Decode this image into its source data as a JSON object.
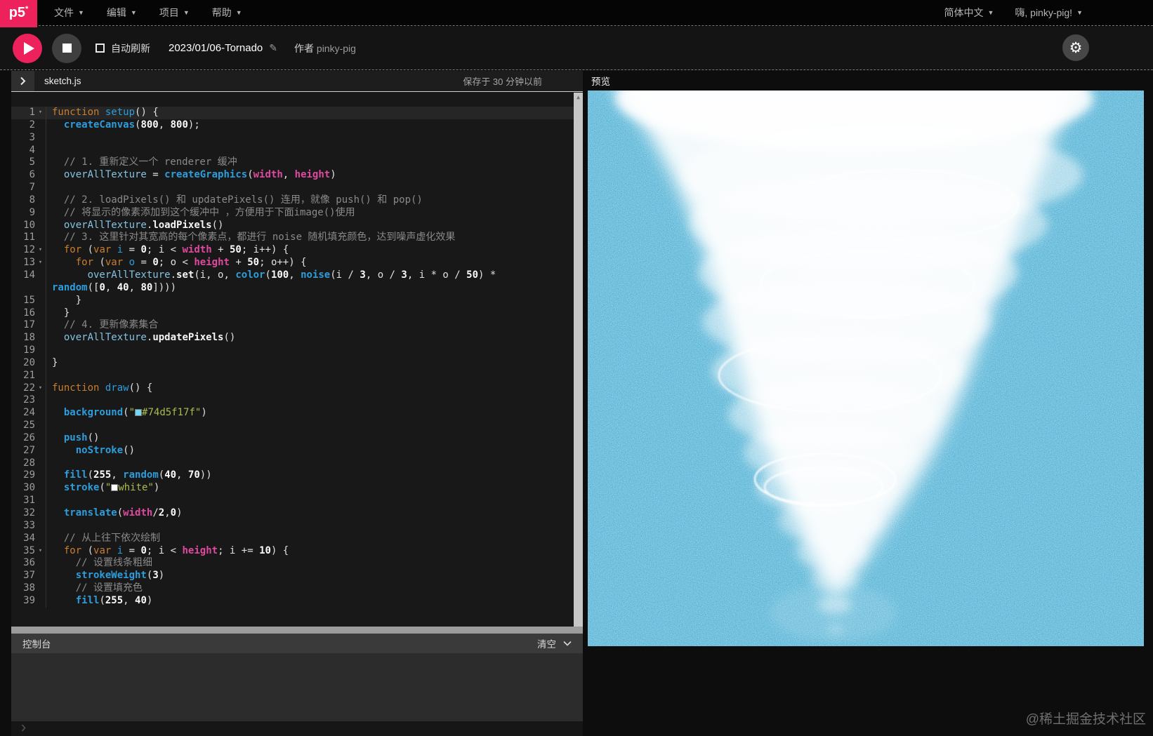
{
  "menubar": {
    "logo": "p5*",
    "items": [
      {
        "label": "文件"
      },
      {
        "label": "编辑"
      },
      {
        "label": "项目"
      },
      {
        "label": "帮助"
      }
    ],
    "language": "简体中文",
    "user": "嗨, pinky-pig!"
  },
  "toolbar": {
    "auto_refresh_label": "自动刷新",
    "project_title": "2023/01/06-Tornado",
    "author_label": "作者",
    "author_name": "pinky-pig"
  },
  "editor": {
    "filename": "sketch.js",
    "saved_status": "保存于 30 分钟以前",
    "lines": [
      {
        "n": 1,
        "fold": true,
        "active": true,
        "tokens": [
          [
            "kw",
            "function"
          ],
          [
            "pl",
            " "
          ],
          [
            "def",
            "setup"
          ],
          [
            "pl",
            "() {"
          ]
        ]
      },
      {
        "n": 2,
        "tokens": [
          [
            "pl",
            "  "
          ],
          [
            "fn",
            "createCanvas"
          ],
          [
            "pl",
            "("
          ],
          [
            "num",
            "800"
          ],
          [
            "pl",
            ", "
          ],
          [
            "num",
            "800"
          ],
          [
            "pl",
            ");"
          ]
        ]
      },
      {
        "n": 3,
        "tokens": []
      },
      {
        "n": 4,
        "tokens": []
      },
      {
        "n": 5,
        "tokens": [
          [
            "pl",
            "  "
          ],
          [
            "com",
            "// 1. 重新定义一个 renderer 缓冲"
          ]
        ]
      },
      {
        "n": 6,
        "tokens": [
          [
            "pl",
            "  "
          ],
          [
            "var",
            "overAllTexture"
          ],
          [
            "pl",
            " = "
          ],
          [
            "fn",
            "createGraphics"
          ],
          [
            "pl",
            "("
          ],
          [
            "p5",
            "width"
          ],
          [
            "pl",
            ", "
          ],
          [
            "p5",
            "height"
          ],
          [
            "pl",
            ")"
          ]
        ]
      },
      {
        "n": 7,
        "tokens": []
      },
      {
        "n": 8,
        "tokens": [
          [
            "pl",
            "  "
          ],
          [
            "com",
            "// 2. loadPixels() 和 updatePixels() 连用，就像 push() 和 pop()"
          ]
        ]
      },
      {
        "n": 9,
        "tokens": [
          [
            "pl",
            "  "
          ],
          [
            "com",
            "// 将显示的像素添加到这个缓冲中 ，方便用于下面image()使用"
          ]
        ]
      },
      {
        "n": 10,
        "tokens": [
          [
            "pl",
            "  "
          ],
          [
            "var",
            "overAllTexture"
          ],
          [
            "pl",
            "."
          ],
          [
            "meth",
            "loadPixels"
          ],
          [
            "pl",
            "()"
          ]
        ]
      },
      {
        "n": 11,
        "tokens": [
          [
            "pl",
            "  "
          ],
          [
            "com",
            "// 3. 这里针对其宽高的每个像素点，都进行 noise 随机填充颜色，达到噪声虚化效果"
          ]
        ]
      },
      {
        "n": 12,
        "fold": true,
        "tokens": [
          [
            "pl",
            "  "
          ],
          [
            "kw",
            "for"
          ],
          [
            "pl",
            " ("
          ],
          [
            "kw",
            "var"
          ],
          [
            "pl",
            " "
          ],
          [
            "def",
            "i"
          ],
          [
            "pl",
            " = "
          ],
          [
            "num",
            "0"
          ],
          [
            "pl",
            "; i < "
          ],
          [
            "p5",
            "width"
          ],
          [
            "pl",
            " + "
          ],
          [
            "num",
            "50"
          ],
          [
            "pl",
            "; i++) {"
          ]
        ]
      },
      {
        "n": 13,
        "fold": true,
        "tokens": [
          [
            "pl",
            "    "
          ],
          [
            "kw",
            "for"
          ],
          [
            "pl",
            " ("
          ],
          [
            "kw",
            "var"
          ],
          [
            "pl",
            " "
          ],
          [
            "def",
            "o"
          ],
          [
            "pl",
            " = "
          ],
          [
            "num",
            "0"
          ],
          [
            "pl",
            "; o < "
          ],
          [
            "p5",
            "height"
          ],
          [
            "pl",
            " + "
          ],
          [
            "num",
            "50"
          ],
          [
            "pl",
            "; o++) {"
          ]
        ]
      },
      {
        "n": 14,
        "tokens": [
          [
            "pl",
            "      "
          ],
          [
            "var",
            "overAllTexture"
          ],
          [
            "pl",
            "."
          ],
          [
            "meth",
            "set"
          ],
          [
            "pl",
            "(i, o, "
          ],
          [
            "fn",
            "color"
          ],
          [
            "pl",
            "("
          ],
          [
            "num",
            "100"
          ],
          [
            "pl",
            ", "
          ],
          [
            "fn",
            "noise"
          ],
          [
            "pl",
            "(i / "
          ],
          [
            "num",
            "3"
          ],
          [
            "pl",
            ", o / "
          ],
          [
            "num",
            "3"
          ],
          [
            "pl",
            ", i * o / "
          ],
          [
            "num",
            "50"
          ],
          [
            "pl",
            ") * "
          ],
          [
            "br",
            ""
          ],
          [
            "fn",
            "random"
          ],
          [
            "pl",
            "(["
          ],
          [
            "num",
            "0"
          ],
          [
            "pl",
            ", "
          ],
          [
            "num",
            "40"
          ],
          [
            "pl",
            ", "
          ],
          [
            "num",
            "80"
          ],
          [
            "pl",
            "])))"
          ]
        ]
      },
      {
        "n": 15,
        "tokens": [
          [
            "pl",
            "    }"
          ]
        ]
      },
      {
        "n": 16,
        "tokens": [
          [
            "pl",
            "  }"
          ]
        ]
      },
      {
        "n": 17,
        "tokens": [
          [
            "pl",
            "  "
          ],
          [
            "com",
            "// 4. 更新像素集合"
          ]
        ]
      },
      {
        "n": 18,
        "tokens": [
          [
            "pl",
            "  "
          ],
          [
            "var",
            "overAllTexture"
          ],
          [
            "pl",
            "."
          ],
          [
            "meth",
            "updatePixels"
          ],
          [
            "pl",
            "()"
          ]
        ]
      },
      {
        "n": 19,
        "tokens": []
      },
      {
        "n": 20,
        "tokens": [
          [
            "pl",
            "}"
          ]
        ]
      },
      {
        "n": 21,
        "tokens": []
      },
      {
        "n": 22,
        "fold": true,
        "tokens": [
          [
            "kw",
            "function"
          ],
          [
            "pl",
            " "
          ],
          [
            "def",
            "draw"
          ],
          [
            "pl",
            "() {"
          ]
        ]
      },
      {
        "n": 23,
        "tokens": []
      },
      {
        "n": 24,
        "tokens": [
          [
            "pl",
            "  "
          ],
          [
            "fn",
            "background"
          ],
          [
            "pl",
            "("
          ],
          [
            "str",
            "\""
          ],
          [
            "chip",
            "#74d5f1"
          ],
          [
            "str",
            "#74d5f17f\""
          ],
          [
            "pl",
            ")"
          ]
        ]
      },
      {
        "n": 25,
        "tokens": []
      },
      {
        "n": 26,
        "tokens": [
          [
            "pl",
            "  "
          ],
          [
            "fn",
            "push"
          ],
          [
            "pl",
            "()"
          ]
        ]
      },
      {
        "n": 27,
        "tokens": [
          [
            "pl",
            "    "
          ],
          [
            "fn",
            "noStroke"
          ],
          [
            "pl",
            "()"
          ]
        ]
      },
      {
        "n": 28,
        "tokens": []
      },
      {
        "n": 29,
        "tokens": [
          [
            "pl",
            "  "
          ],
          [
            "fn",
            "fill"
          ],
          [
            "pl",
            "("
          ],
          [
            "num",
            "255"
          ],
          [
            "pl",
            ", "
          ],
          [
            "fn",
            "random"
          ],
          [
            "pl",
            "("
          ],
          [
            "num",
            "40"
          ],
          [
            "pl",
            ", "
          ],
          [
            "num",
            "70"
          ],
          [
            "pl",
            "))"
          ]
        ]
      },
      {
        "n": 30,
        "tokens": [
          [
            "pl",
            "  "
          ],
          [
            "fn",
            "stroke"
          ],
          [
            "pl",
            "("
          ],
          [
            "str",
            "\""
          ],
          [
            "chip",
            "#ffffff"
          ],
          [
            "str",
            "white\""
          ],
          [
            "pl",
            ")"
          ]
        ]
      },
      {
        "n": 31,
        "tokens": []
      },
      {
        "n": 32,
        "tokens": [
          [
            "pl",
            "  "
          ],
          [
            "fn",
            "translate"
          ],
          [
            "pl",
            "("
          ],
          [
            "p5",
            "width"
          ],
          [
            "pl",
            "/"
          ],
          [
            "num",
            "2"
          ],
          [
            "pl",
            ","
          ],
          [
            "num",
            "0"
          ],
          [
            "pl",
            ")"
          ]
        ]
      },
      {
        "n": 33,
        "tokens": []
      },
      {
        "n": 34,
        "tokens": [
          [
            "pl",
            "  "
          ],
          [
            "com",
            "// 从上往下依次绘制"
          ]
        ]
      },
      {
        "n": 35,
        "fold": true,
        "tokens": [
          [
            "pl",
            "  "
          ],
          [
            "kw",
            "for"
          ],
          [
            "pl",
            " ("
          ],
          [
            "kw",
            "var"
          ],
          [
            "pl",
            " "
          ],
          [
            "def",
            "i"
          ],
          [
            "pl",
            " = "
          ],
          [
            "num",
            "0"
          ],
          [
            "pl",
            "; i < "
          ],
          [
            "p5",
            "height"
          ],
          [
            "pl",
            "; i += "
          ],
          [
            "num",
            "10"
          ],
          [
            "pl",
            ") {"
          ]
        ]
      },
      {
        "n": 36,
        "tokens": [
          [
            "pl",
            "    "
          ],
          [
            "com",
            "// 设置线条粗细"
          ]
        ]
      },
      {
        "n": 37,
        "tokens": [
          [
            "pl",
            "    "
          ],
          [
            "fn",
            "strokeWeight"
          ],
          [
            "pl",
            "("
          ],
          [
            "num",
            "3"
          ],
          [
            "pl",
            ")"
          ]
        ]
      },
      {
        "n": 38,
        "tokens": [
          [
            "pl",
            "    "
          ],
          [
            "com",
            "// 设置填充色"
          ]
        ]
      },
      {
        "n": 39,
        "tokens": [
          [
            "pl",
            "    "
          ],
          [
            "fn",
            "fill"
          ],
          [
            "pl",
            "("
          ],
          [
            "num",
            "255"
          ],
          [
            "pl",
            ", "
          ],
          [
            "num",
            "40"
          ],
          [
            "pl",
            ")"
          ]
        ]
      }
    ]
  },
  "console": {
    "title": "控制台",
    "clear_label": "清空",
    "prompt": "❯"
  },
  "preview": {
    "label": "预览",
    "canvas_color": "#4fb1d5"
  },
  "watermark": "@稀土掘金技术社区",
  "colors": {
    "accent": "#ed225d",
    "canvas_blue": "#4fb1d5"
  }
}
